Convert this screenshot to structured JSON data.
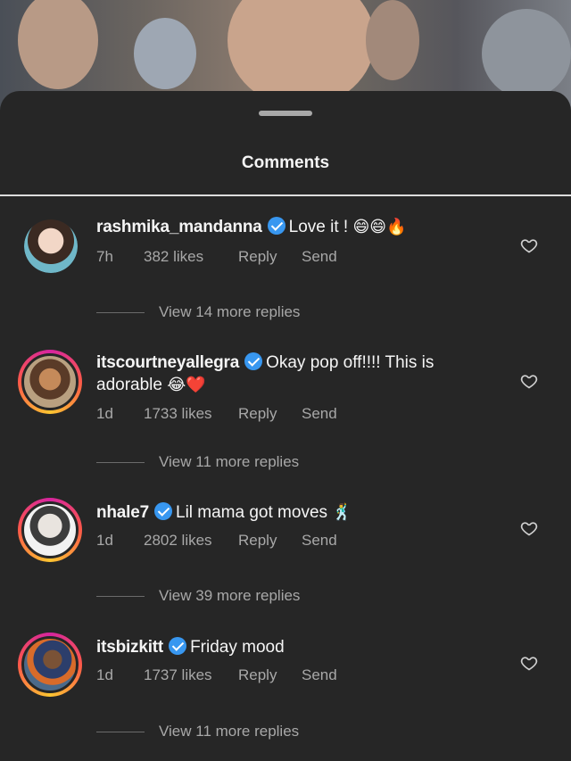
{
  "header": {
    "title": "Comments"
  },
  "comments": [
    {
      "username": "rashmika_mandanna",
      "verified": true,
      "text": "Love it ! ",
      "emoji": "😄😄🔥",
      "time": "7h",
      "likes": "382 likes",
      "reply_label": "Reply",
      "send_label": "Send",
      "view_replies": "View 14 more replies",
      "story_ring": false
    },
    {
      "username": "itscourtneyallegra",
      "verified": true,
      "text": "Okay pop off!!!! This is adorable ",
      "emoji": "😂❤️",
      "time": "1d",
      "likes": "1733 likes",
      "reply_label": "Reply",
      "send_label": "Send",
      "view_replies": "View 11 more replies",
      "story_ring": true
    },
    {
      "username": "nhale7",
      "verified": true,
      "text": "Lil mama got moves ",
      "emoji": "🕺",
      "time": "1d",
      "likes": "2802 likes",
      "reply_label": "Reply",
      "send_label": "Send",
      "view_replies": "View 39 more replies",
      "story_ring": true
    },
    {
      "username": "itsbizkitt",
      "verified": true,
      "text": "Friday mood",
      "emoji": "",
      "time": "1d",
      "likes": "1737 likes",
      "reply_label": "Reply",
      "send_label": "Send",
      "view_replies": "View 11 more replies",
      "story_ring": true
    }
  ],
  "icons": {
    "heart": "heart-outline-icon",
    "verified": "verified-badge-icon",
    "handle": "drag-handle"
  },
  "colors": {
    "background": "#262626",
    "verified": "#3897f0",
    "secondary_text": "#a8a8a8"
  }
}
